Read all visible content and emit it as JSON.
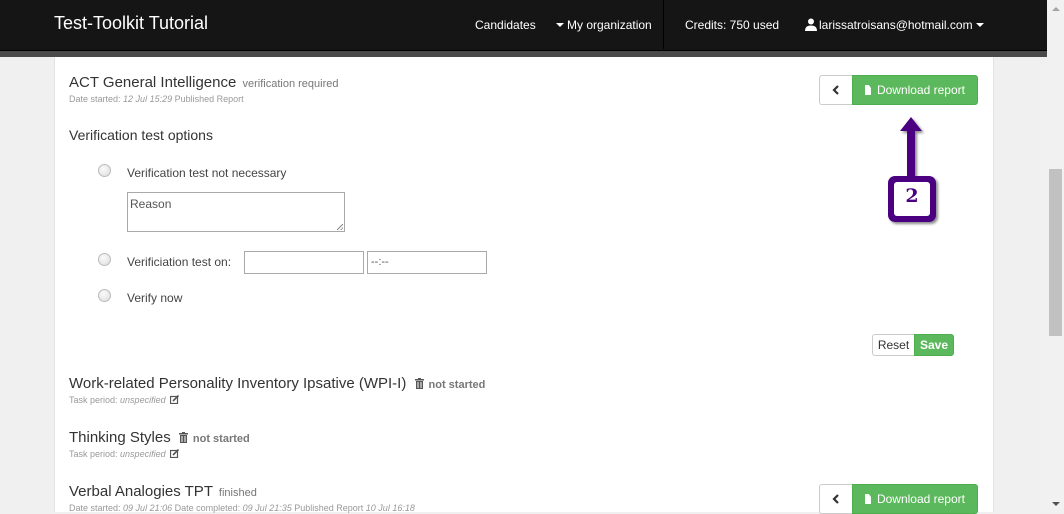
{
  "navbar": {
    "brand": "Test-Toolkit Tutorial",
    "items": [
      {
        "label": "Candidates"
      },
      {
        "label": "My organization",
        "icon": "caret-down-icon"
      },
      {
        "label": "Credits: 750 used"
      },
      {
        "label": "larissatroisans@hotmail.com",
        "icon": "user-icon",
        "trailing_icon": "caret-down-icon"
      }
    ]
  },
  "tasks": [
    {
      "title": "ACT General Intelligence",
      "status": "verification required",
      "meta_label_started": "Date started:",
      "meta_started": "12 Jul 15:29",
      "meta_published": "Published Report",
      "actions": {
        "back_icon": "chevron-left-icon",
        "download_label": "Download report",
        "download_icon": "file-icon"
      }
    },
    {
      "title": "Work-related Personality Inventory Ipsative (WPI-I)",
      "status": "not started",
      "meta_label": "Task period:",
      "meta_value": "unspecified",
      "icons": [
        "trash-icon",
        "edit-icon"
      ]
    },
    {
      "title": "Thinking Styles",
      "status": "not started",
      "meta_label": "Task period:",
      "meta_value": "unspecified",
      "icons": [
        "trash-icon",
        "edit-icon"
      ]
    },
    {
      "title": "Verbal Analogies TPT",
      "status": "finished",
      "meta_label_started": "Date started:",
      "meta_started": "09 Jul 21:06",
      "meta_label_completed": "Date completed:",
      "meta_completed": "09 Jul 21:35",
      "meta_label_published": "Published Report",
      "meta_published": "10 Jul 16:18",
      "actions": {
        "back_icon": "chevron-left-icon",
        "download_label": "Download report",
        "download_icon": "file-icon"
      }
    }
  ],
  "verification": {
    "heading": "Verification test options",
    "options": [
      {
        "label": "Verification test not necessary",
        "selected": false
      },
      {
        "label": "Verificiation test on:",
        "selected": false
      },
      {
        "label": "Verify now",
        "selected": false
      }
    ],
    "reason_placeholder": "Reason",
    "date_value": "",
    "time_placeholder": "--:--",
    "reset_label": "Reset",
    "save_label": "Save"
  },
  "annotation": {
    "step_number": "2",
    "color": "#4b0082"
  },
  "colors": {
    "navbar": "#151515",
    "success": "#5cb85c",
    "background": "#f0f0f0"
  }
}
